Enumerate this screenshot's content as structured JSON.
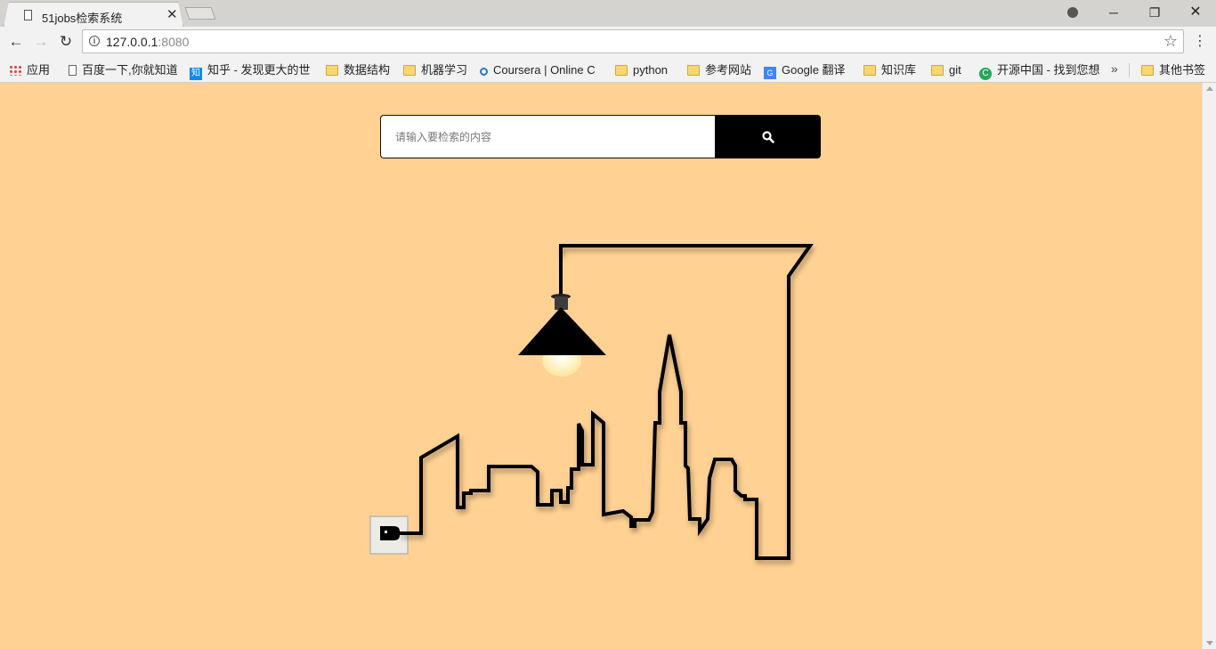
{
  "browser": {
    "tab_title": "51jobs检索系统",
    "url_host": "127.0.0.1",
    "url_port": ":8080",
    "bookmarks": [
      {
        "label": "应用",
        "icon": "apps-icon"
      },
      {
        "label": "百度一下,你就知道",
        "icon": "page-icon"
      },
      {
        "label": "知乎 - 发现更大的世",
        "icon": "zhihu-icon"
      },
      {
        "label": "数据结构",
        "icon": "folder-icon"
      },
      {
        "label": "机器学习",
        "icon": "folder-icon"
      },
      {
        "label": "Coursera | Online C",
        "icon": "coursera-icon"
      },
      {
        "label": "python",
        "icon": "folder-icon"
      },
      {
        "label": "参考网站",
        "icon": "folder-icon"
      },
      {
        "label": "Google 翻译",
        "icon": "google-translate-icon"
      },
      {
        "label": "知识库",
        "icon": "folder-icon"
      },
      {
        "label": "git",
        "icon": "folder-icon"
      },
      {
        "label": "开源中国 - 找到您想",
        "icon": "oschina-icon"
      }
    ],
    "other_bookmarks": "其他书签"
  },
  "search": {
    "placeholder": "请输入要检索的内容",
    "value": ""
  },
  "colors": {
    "page_background": "#ffd193",
    "search_button": "#000000",
    "line": "#000000",
    "bulb_glow": "#fff3c8"
  }
}
